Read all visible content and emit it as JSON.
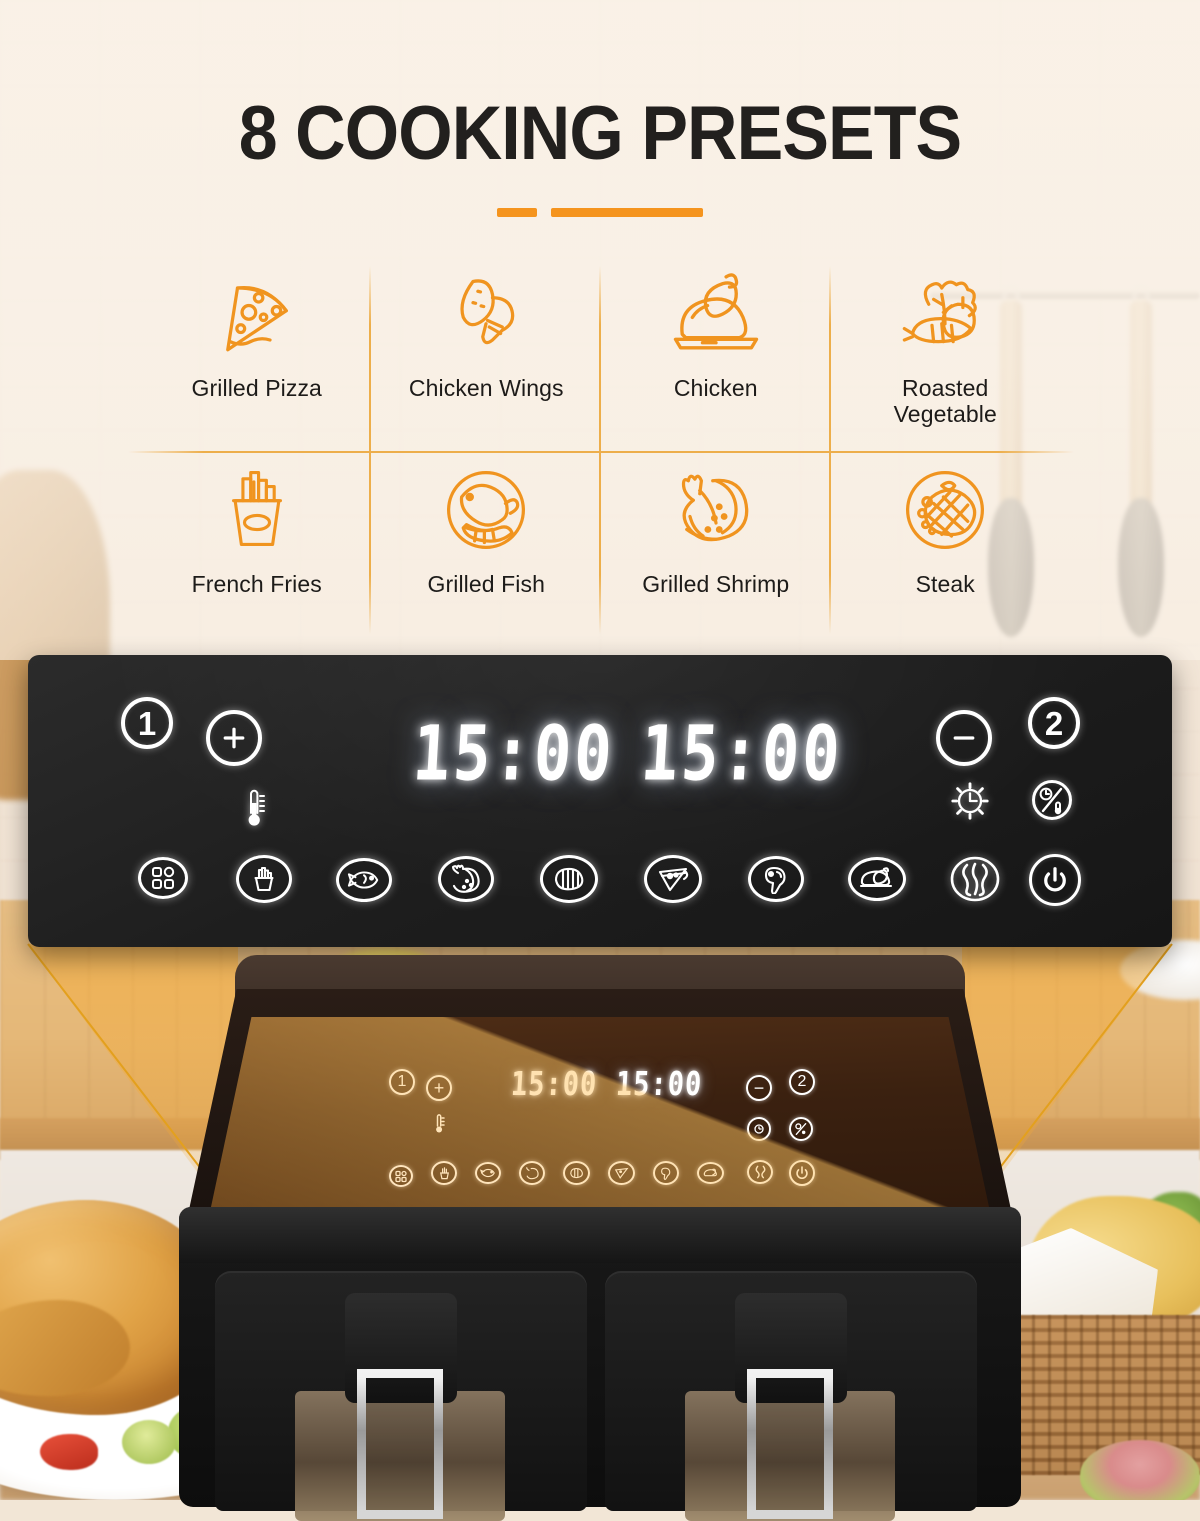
{
  "header": {
    "title": "8 COOKING PRESETS"
  },
  "presets": {
    "row1": [
      {
        "label": "Grilled Pizza",
        "icon": "pizza-icon",
        "lines": [
          "Grilled Pizza"
        ]
      },
      {
        "label": "Chicken Wings",
        "icon": "wings-icon",
        "lines": [
          "Chicken Wings"
        ]
      },
      {
        "label": "Chicken",
        "icon": "chicken-icon",
        "lines": [
          "Chicken"
        ]
      },
      {
        "label": "Roasted Vegetable",
        "icon": "vegetable-icon",
        "lines": [
          "Roasted",
          "Vegetable"
        ]
      }
    ],
    "row2": [
      {
        "label": "French Fries",
        "icon": "fries-icon",
        "lines": [
          "French Fries"
        ]
      },
      {
        "label": "Grilled Fish",
        "icon": "fish-icon",
        "lines": [
          "Grilled Fish"
        ]
      },
      {
        "label": "Grilled Shrimp",
        "icon": "shrimp-icon",
        "lines": [
          "Grilled Shrimp"
        ]
      },
      {
        "label": "Steak",
        "icon": "steak-icon",
        "lines": [
          "Steak"
        ]
      }
    ]
  },
  "control_panel": {
    "zone_one_label": "1",
    "zone_two_label": "2",
    "increase_label": "+",
    "decrease_label": "−",
    "display_left": "15:00",
    "display_right": "15:00",
    "icons": {
      "temperature": "thermometer-icon",
      "timer": "timer-icon",
      "time_temp_toggle": "time-temp-toggle-icon",
      "sync_cook": "sync-cook-icon",
      "power": "power-icon",
      "menu": "menu-grid-icon"
    },
    "preset_buttons": [
      "menu-grid-icon",
      "fries-icon",
      "fish-icon",
      "shrimp-icon",
      "wings-icon",
      "pizza-icon",
      "steak-icon",
      "chicken-icon",
      "vegetable-icon"
    ]
  },
  "device": {
    "display_left": "15:00",
    "display_right": "15:00",
    "zone_one_label": "1",
    "zone_two_label": "2",
    "increase_label": "+",
    "decrease_label": "−"
  },
  "colors": {
    "accent_orange": "#f5941e",
    "grid_line": "#edae4a",
    "title_dark": "#22201e",
    "panel_black": "#1e1e1e",
    "lcd_white": "#ffffff"
  }
}
